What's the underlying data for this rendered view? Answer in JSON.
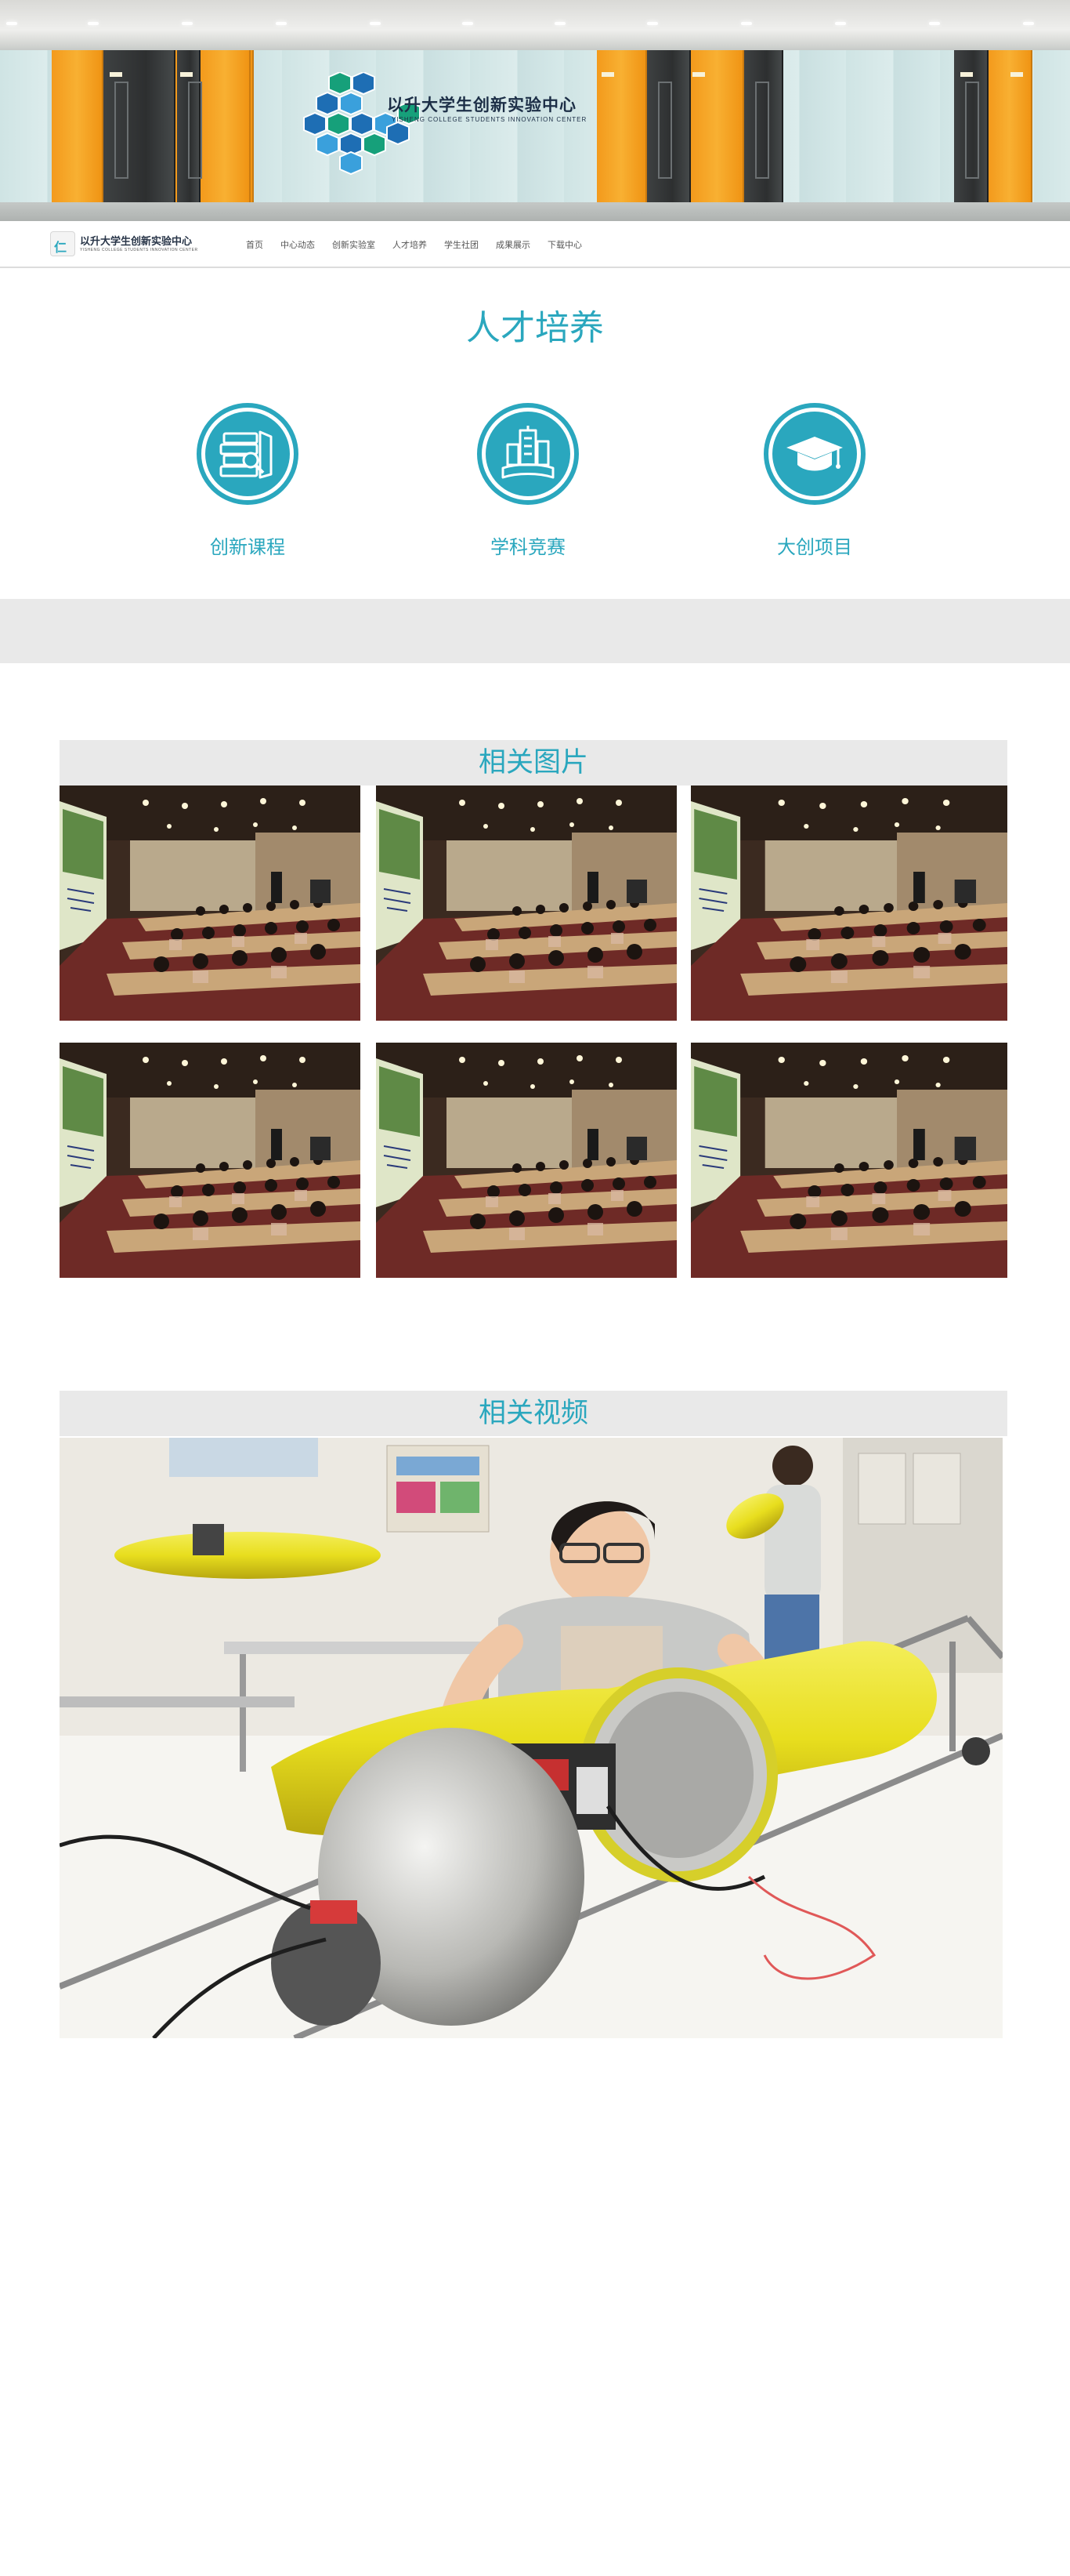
{
  "banner": {
    "title": "以升大学生创新实验中心",
    "subtitle": "YISHENG COLLEGE STUDENTS INNOVATION CENTER",
    "colors": {
      "orange": "#f39a1c",
      "hex_blue": "#1e6eb4",
      "hex_green": "#16a07a",
      "hex_light": "#3aa0dc"
    }
  },
  "nav": {
    "logo_icon_text": "仁",
    "logo_title": "以升大学生创新实验中心",
    "logo_subtitle": "YISHENG COLLEGE STUDENTS INNOVATION CENTER",
    "items": [
      {
        "label": "首页"
      },
      {
        "label": "中心动态"
      },
      {
        "label": "创新实验室"
      },
      {
        "label": "人才培养"
      },
      {
        "label": "学生社团"
      },
      {
        "label": "成果展示"
      },
      {
        "label": "下载中心"
      }
    ]
  },
  "talent": {
    "heading": "人才培养",
    "features": [
      {
        "label": "创新课程",
        "icon": "books-magnifier-icon"
      },
      {
        "label": "学科竞赛",
        "icon": "city-building-icon"
      },
      {
        "label": "大创项目",
        "icon": "graduation-cap-icon"
      }
    ]
  },
  "gallery": {
    "heading": "相关图片",
    "photos": [
      {
        "image": "lecture-hall-photo"
      },
      {
        "image": "lecture-hall-photo"
      },
      {
        "image": "lecture-hall-photo"
      },
      {
        "image": "lecture-hall-photo"
      },
      {
        "image": "lecture-hall-photo"
      },
      {
        "image": "lecture-hall-photo"
      }
    ]
  },
  "video": {
    "heading": "相关视频",
    "image": "student-robot-photo"
  },
  "theme": {
    "accent": "#2aa7be",
    "band_gray": "#e9e9e9"
  }
}
